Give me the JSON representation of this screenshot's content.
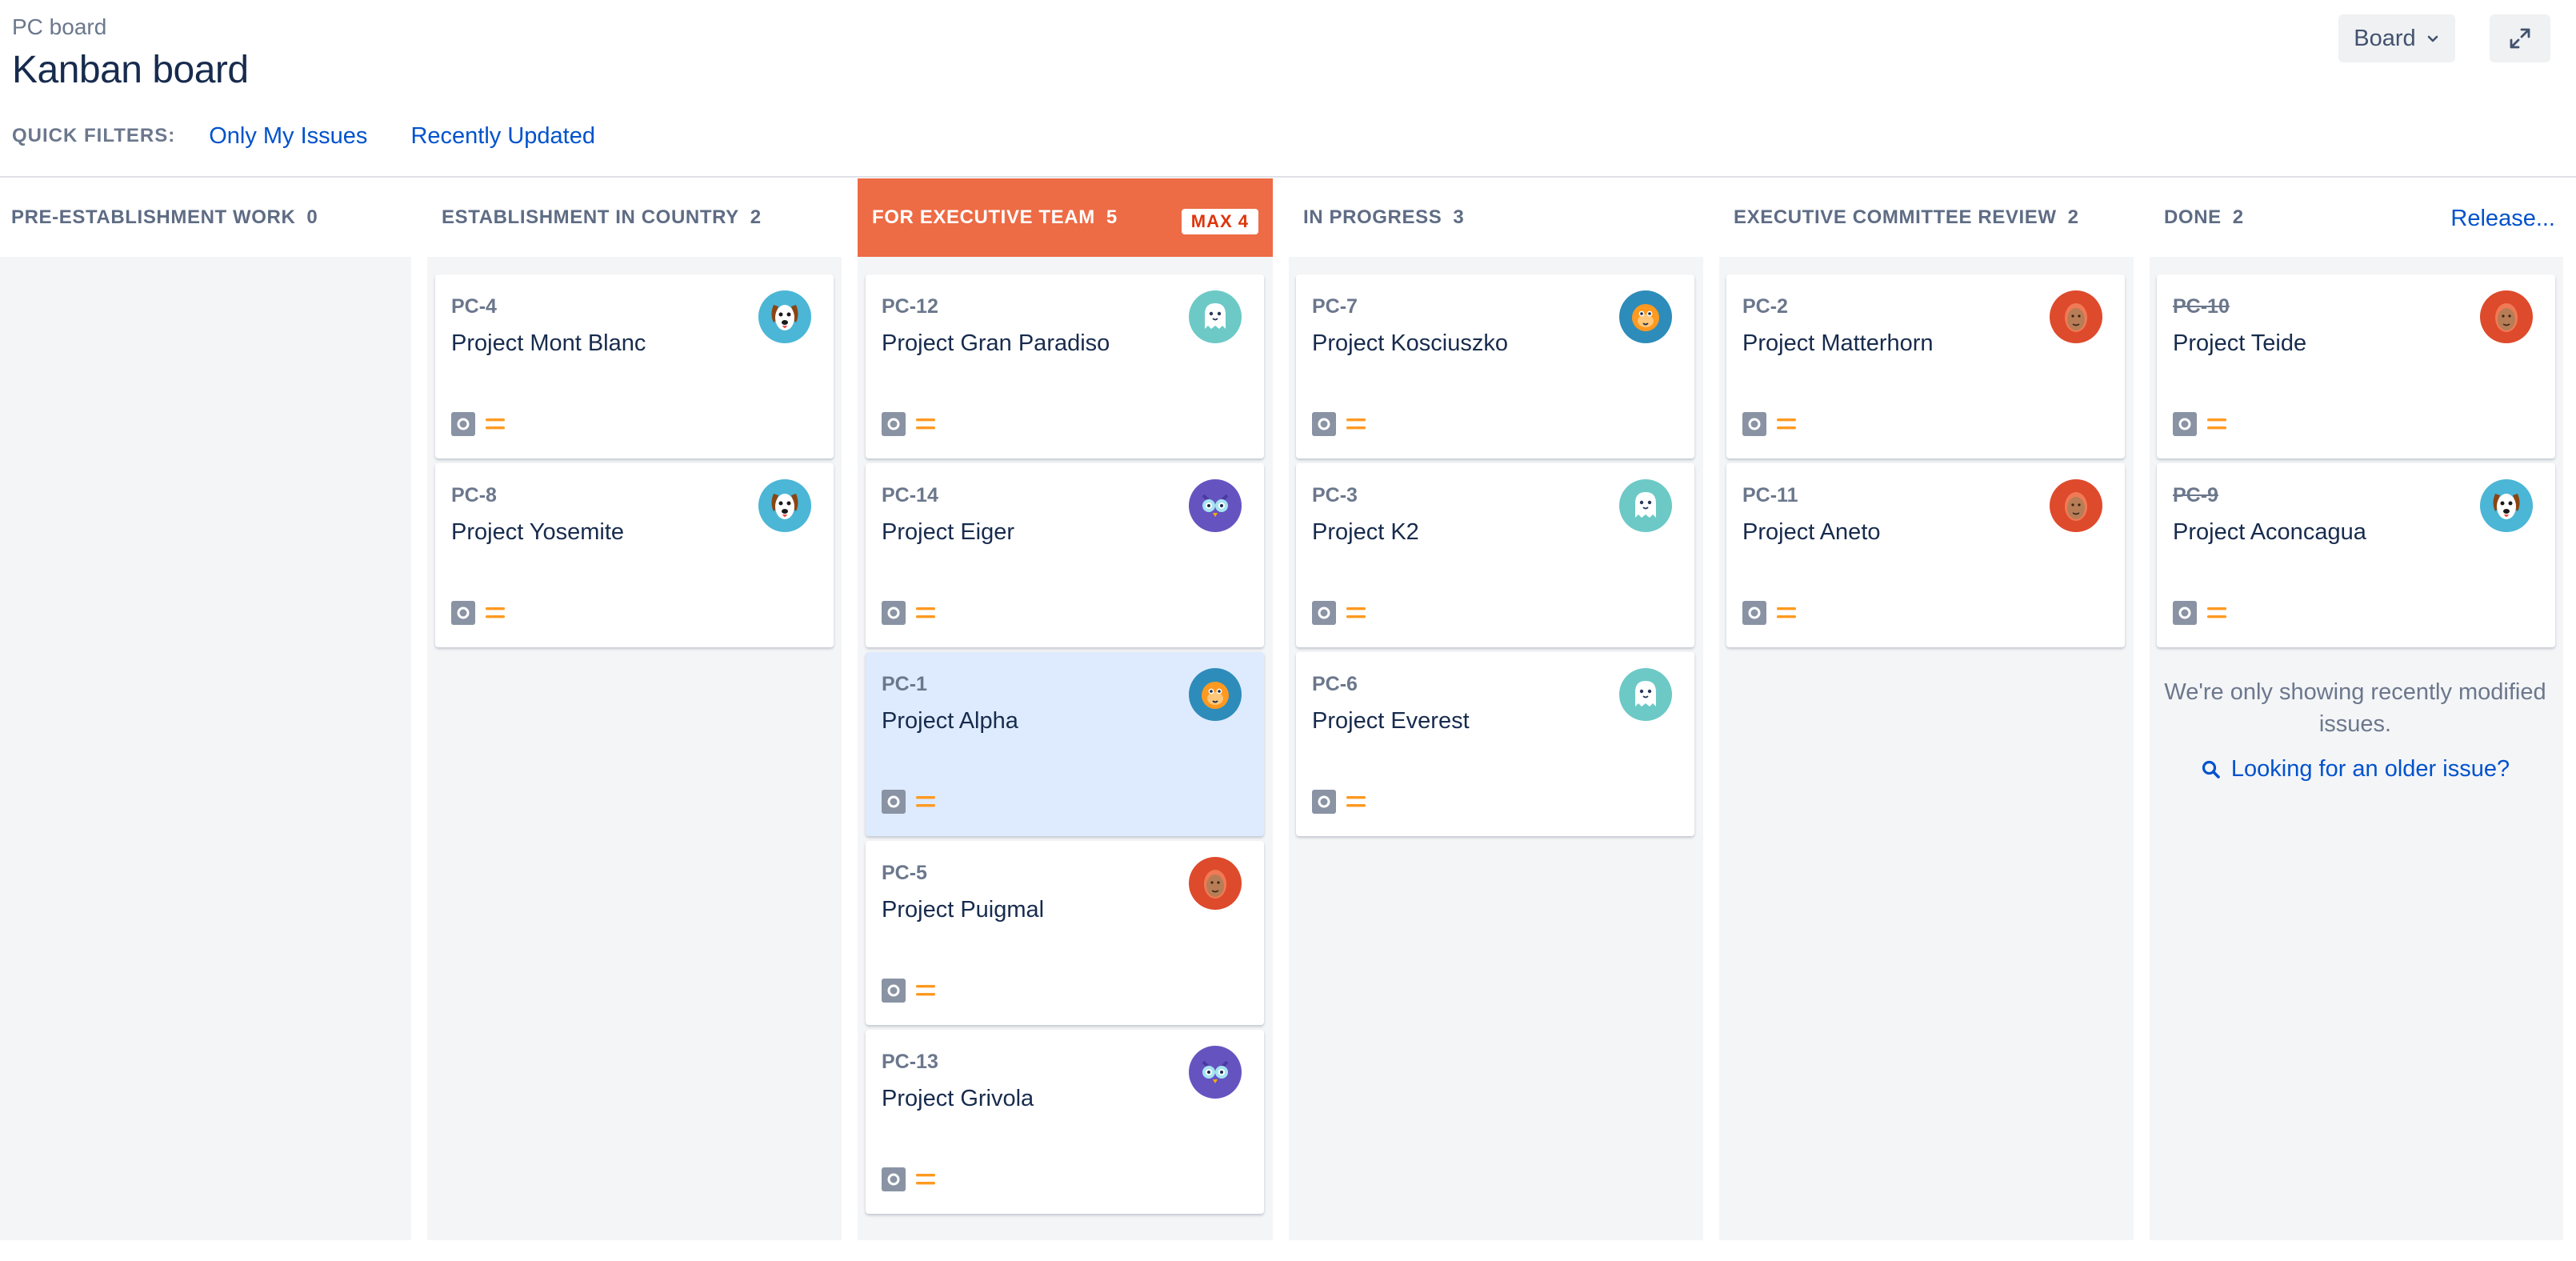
{
  "header": {
    "breadcrumb": "PC board",
    "title": "Kanban board",
    "quick_filters_label": "QUICK FILTERS:",
    "quick_filters": [
      "Only My Issues",
      "Recently Updated"
    ],
    "board_button_label": "Board"
  },
  "columns": [
    {
      "name": "PRE-ESTABLISHMENT WORK",
      "count": "0"
    },
    {
      "name": "ESTABLISHMENT IN COUNTRY",
      "count": "2"
    },
    {
      "name": "FOR EXECUTIVE TEAM",
      "count": "5",
      "max_badge": "MAX 4"
    },
    {
      "name": "IN PROGRESS",
      "count": "3"
    },
    {
      "name": "EXECUTIVE COMMITTEE REVIEW",
      "count": "2"
    },
    {
      "name": "DONE",
      "count": "2",
      "release_link": "Release..."
    }
  ],
  "cards": {
    "c1": [
      {
        "key": "PC-4",
        "summary": "Project Mont Blanc",
        "avatar": "dog-avatar"
      },
      {
        "key": "PC-8",
        "summary": "Project Yosemite",
        "avatar": "dog-avatar"
      }
    ],
    "c2": [
      {
        "key": "PC-12",
        "summary": "Project Gran Paradiso",
        "avatar": "ghost-avatar"
      },
      {
        "key": "PC-14",
        "summary": "Project Eiger",
        "avatar": "owl-avatar"
      },
      {
        "key": "PC-1",
        "summary": "Project Alpha",
        "avatar": "monkey-avatar",
        "selected": true
      },
      {
        "key": "PC-5",
        "summary": "Project Puigmal",
        "avatar": "person-avatar"
      },
      {
        "key": "PC-13",
        "summary": "Project Grivola",
        "avatar": "owl-avatar"
      }
    ],
    "c3": [
      {
        "key": "PC-7",
        "summary": "Project Kosciuszko",
        "avatar": "monkey-avatar"
      },
      {
        "key": "PC-3",
        "summary": "Project K2",
        "avatar": "ghost-avatar"
      },
      {
        "key": "PC-6",
        "summary": "Project Everest",
        "avatar": "ghost-avatar"
      }
    ],
    "c4": [
      {
        "key": "PC-2",
        "summary": "Project Matterhorn",
        "avatar": "person-avatar"
      },
      {
        "key": "PC-11",
        "summary": "Project Aneto",
        "avatar": "person-avatar"
      }
    ],
    "c5": [
      {
        "key": "PC-10",
        "summary": "Project Teide",
        "avatar": "person-avatar",
        "done": true
      },
      {
        "key": "PC-9",
        "summary": "Project Aconcagua",
        "avatar": "dog-avatar",
        "done": true
      }
    ]
  },
  "done_note": "We're only showing recently modified issues.",
  "older_issue_link": "Looking for an older issue?",
  "icons": {
    "issue_type": "task-icon",
    "priority": "medium-priority-icon",
    "expand": "expand-icon",
    "chevron": "chevron-down-icon",
    "search": "search-icon"
  },
  "colors": {
    "accent": "#0052cc",
    "exec_column": "#ed6b45",
    "selected_card": "#deebff",
    "priority": "#ff991f"
  }
}
